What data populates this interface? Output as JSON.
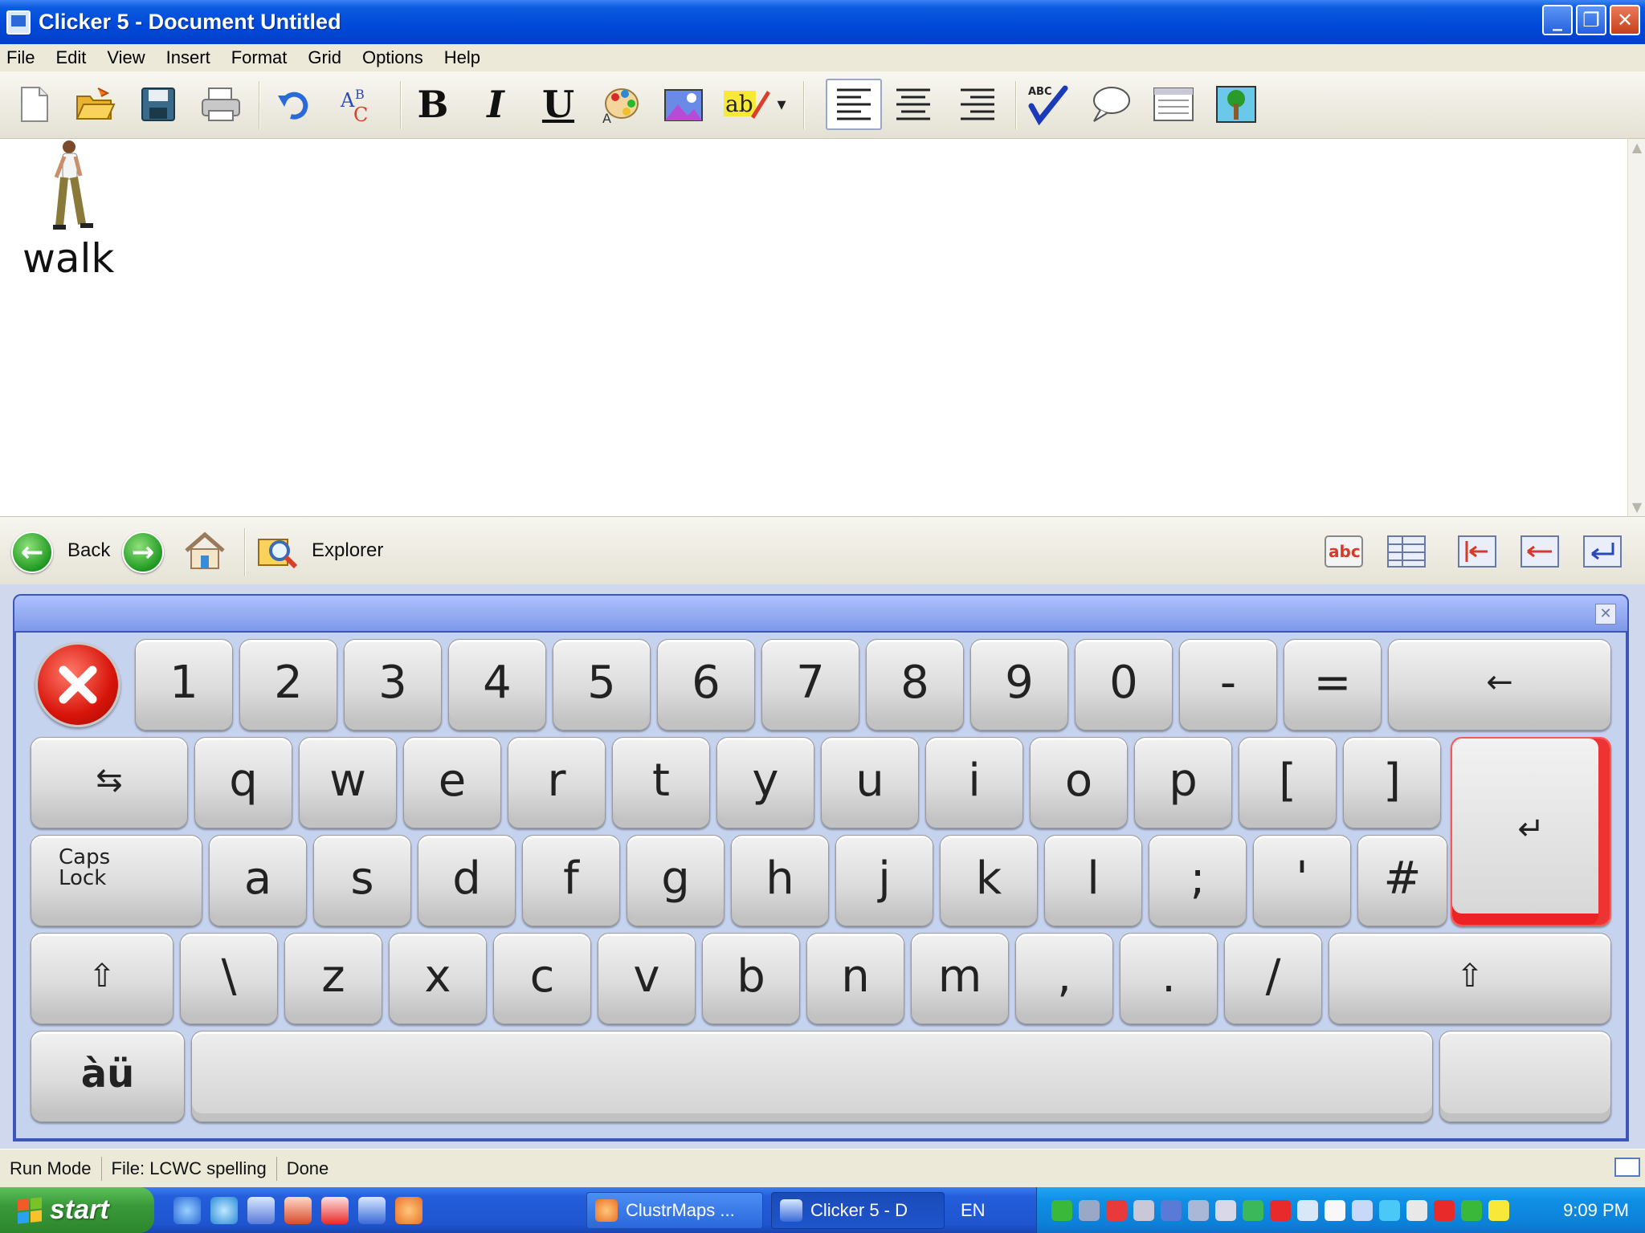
{
  "window": {
    "title": "Clicker 5 - Document Untitled",
    "buttons": [
      "_",
      "❐",
      "✕"
    ]
  },
  "menu": [
    "File",
    "Edit",
    "View",
    "Insert",
    "Format",
    "Grid",
    "Options",
    "Help"
  ],
  "toolbar": {
    "icons": [
      "new-document",
      "open-folder",
      "save-disk",
      "print",
      "undo",
      "font-abc",
      "bold",
      "italic",
      "underline",
      "text-color-palette",
      "insert-picture",
      "highlight-text",
      "dropdown-arrow",
      "align-left",
      "align-center",
      "align-right",
      "spell-check",
      "speech-bubble",
      "notepad",
      "tree-picture"
    ],
    "bold_label": "B",
    "italic_label": "I",
    "underline_label": "U",
    "abc_label": "A",
    "dropdown": "▾"
  },
  "document": {
    "picture_word": "walk"
  },
  "navbar": {
    "back_label": "Back",
    "explorer_label": "Explorer",
    "back_arrow": "←",
    "forward_arrow": "→"
  },
  "keyboard": {
    "row1": [
      "1",
      "2",
      "3",
      "4",
      "5",
      "6",
      "7",
      "8",
      "9",
      "0",
      "-",
      "="
    ],
    "backspace": "←",
    "tab": "⇆",
    "row2": [
      "q",
      "w",
      "e",
      "r",
      "t",
      "y",
      "u",
      "i",
      "o",
      "p",
      "[",
      "]"
    ],
    "caps": "Caps\nLock",
    "row3": [
      "a",
      "s",
      "d",
      "f",
      "g",
      "h",
      "j",
      "k",
      "l",
      ";",
      "'",
      "#"
    ],
    "shift": "⇧",
    "row4": [
      "\\",
      "z",
      "x",
      "c",
      "v",
      "b",
      "n",
      "m",
      ",",
      ".",
      "/"
    ],
    "accent": "àü",
    "enter": "↵"
  },
  "status": {
    "mode": "Run Mode",
    "file": "File: LCWC spelling",
    "state": "Done"
  },
  "taskbar": {
    "start_label": "start",
    "tasks": [
      "ClustrMaps ...",
      "Clicker 5 - D"
    ],
    "lang": "EN",
    "clock": "9:09 PM"
  }
}
